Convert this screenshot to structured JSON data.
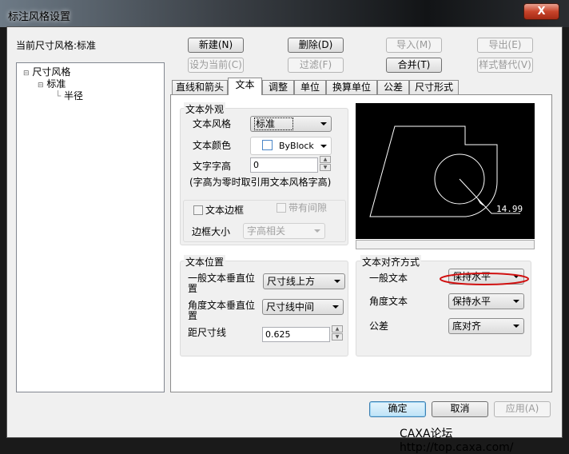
{
  "window": {
    "title": "标注风格设置",
    "close_icon": "close-icon"
  },
  "current_style_label": "当前尺寸风格:标准",
  "buttons": {
    "new": "新建(N)",
    "delete": "删除(D)",
    "import": "导入(M)",
    "export": "导出(E)",
    "set_current": "设为当前(C)",
    "filter": "过滤(F)",
    "merge": "合并(T)",
    "override": "样式替代(V)"
  },
  "tree": {
    "root": "尺寸风格",
    "child": "标准",
    "grandchild": "半径"
  },
  "tabs": [
    "直线和箭头",
    "文本",
    "调整",
    "单位",
    "换算单位",
    "公差",
    "尺寸形式"
  ],
  "active_tab": "文本",
  "appearance": {
    "title": "文本外观",
    "style_label": "文本风格",
    "style_value": "标准",
    "color_label": "文本颜色",
    "color_value": "ByBlock",
    "height_label": "文字字高",
    "height_value": "0",
    "note": "(字高为零时取引用文本风格字高)",
    "frame_label": "文本边框",
    "frame_checked": false,
    "gap_label": "带有间隙",
    "gap_checked": false,
    "frame_size_label": "边框大小",
    "frame_size_value": "字高相关"
  },
  "position": {
    "title": "文本位置",
    "general_label": "一般文本垂直位置",
    "general_value": "尺寸线上方",
    "angle_label": "角度文本垂直位置",
    "angle_value": "尺寸线中间",
    "offset_label": "距尺寸线",
    "offset_value": "0.625"
  },
  "alignment": {
    "title": "文本对齐方式",
    "general_label": "一般文本",
    "general_value": "保持水平",
    "angle_label": "角度文本",
    "angle_value": "保持水平",
    "tolerance_label": "公差",
    "tolerance_value": "底对齐"
  },
  "preview": {
    "dimension_text": "14.99"
  },
  "footer": {
    "ok": "确定",
    "cancel": "取消",
    "apply": "应用(A)"
  },
  "watermark": "CAXA论坛 http://top.caxa.com/",
  "colors": {
    "annotation": "#d01010",
    "preview_bg": "#000000"
  }
}
